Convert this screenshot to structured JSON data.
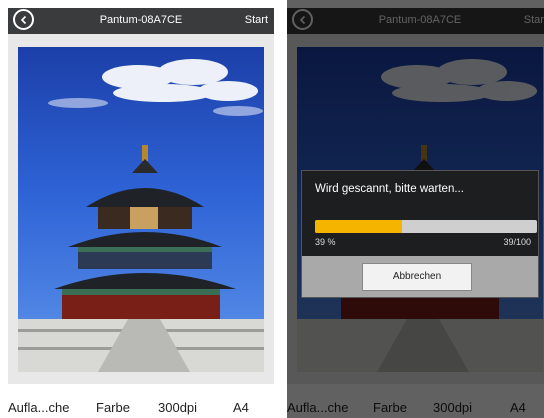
{
  "left_screen": {
    "title": "Pantum-08A7CE",
    "start_label": "Start",
    "settings": [
      "Aufla...che",
      "Farbe",
      "300dpi",
      "A4"
    ]
  },
  "right_screen": {
    "title": "Pantum-08A7CE",
    "start_label": "Start",
    "settings": [
      "Aufla...che",
      "Farbe",
      "300dpi",
      "A4"
    ],
    "dialog": {
      "message": "Wird gescannt, bitte warten...",
      "progress_fraction": 0.39,
      "percent_label": "39 %",
      "count_label": "39/100",
      "cancel_label": "Abbrechen"
    }
  },
  "colors": {
    "top_bar": "#3a3b3d",
    "progress_fill": "#f5b400",
    "progress_track": "#cfcfcf",
    "dialog_bg": "#1d1e20"
  },
  "icons": {
    "back": "back-chevron-icon"
  }
}
